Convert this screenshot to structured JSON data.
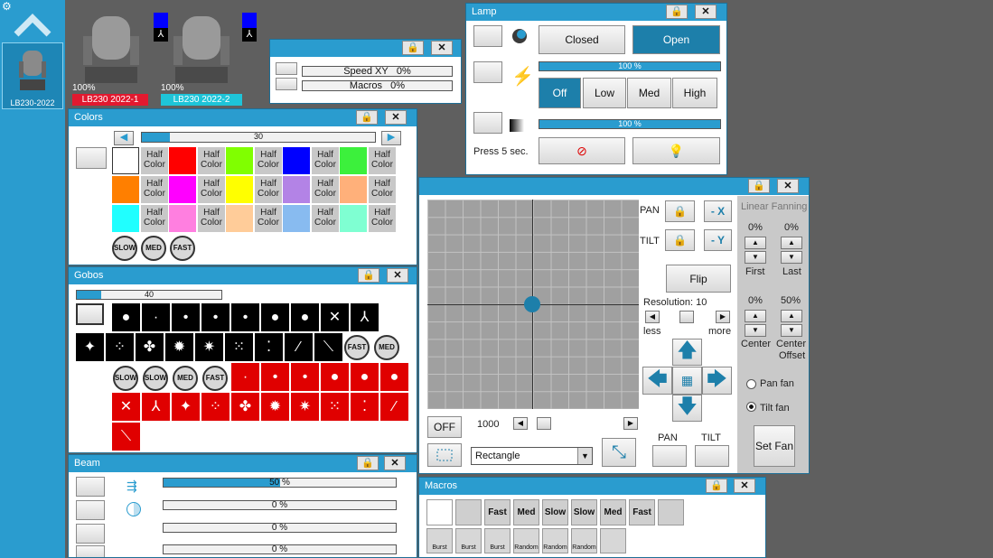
{
  "fixture_bar": {
    "selected_label": "LB230-2022",
    "fixtures": [
      {
        "percent": "100%",
        "label": "LB230 2022-1",
        "color": "#e2192f"
      },
      {
        "percent": "100%",
        "label": "LB230 2022-2",
        "color": "#1ec4d8"
      }
    ]
  },
  "speed_win": {
    "rows": [
      {
        "label": "Speed XY",
        "value": "0%"
      },
      {
        "label": "Macros",
        "value": "0%"
      }
    ]
  },
  "lamp": {
    "title": "Lamp",
    "closed": "Closed",
    "open": "Open",
    "dim_text": "100 %",
    "levels": [
      "Off",
      "Low",
      "Med",
      "High"
    ],
    "dim2_text": "100 %",
    "press": "Press 5 sec."
  },
  "colors": {
    "title": "Colors",
    "slider_value": "30",
    "half_line1": "Half",
    "half_line2": "Color",
    "swatches": [
      "#ffffff",
      "#ff0000",
      "#80ff00",
      "#0000ff",
      "#3cf03c",
      "#ff7f00",
      "#ff00ff",
      "#ffff00",
      "#b383e6",
      "#ffb07a",
      "#20ffff",
      "#ff7fe0",
      "#ffcc99",
      "#88bbf0",
      "#7fffd2"
    ],
    "speeds": [
      "SLOW",
      "MED",
      "FAST"
    ]
  },
  "gobos": {
    "title": "Gobos",
    "slider_value": "40",
    "speeds": [
      "SLOW",
      "SLOW",
      "MED",
      "FAST"
    ],
    "speeds2": [
      "FAST",
      "MED"
    ]
  },
  "beam": {
    "title": "Beam",
    "bars": [
      "50 %",
      "0 %",
      "0 %",
      "0 %"
    ],
    "values": [
      0.5,
      0,
      0,
      0
    ]
  },
  "macros": {
    "title": "Macros",
    "row1": [
      "",
      "",
      "Fast",
      "Med",
      "Slow",
      "Slow",
      "Med",
      "Fast",
      ""
    ],
    "row2": [
      "Burst",
      "Burst",
      "Burst",
      "Random",
      "Random",
      "Random",
      ""
    ]
  },
  "pantilt": {
    "pan": "PAN",
    "tilt": "TILT",
    "minus_x": "- X",
    "minus_y": "- Y",
    "flip": "Flip",
    "resolution": "Resolution: 10",
    "less": "less",
    "more": "more",
    "off": "OFF",
    "value": "1000",
    "shape": "Rectangle",
    "pan_btn": "PAN",
    "tilt_btn": "TILT",
    "fanning_title": "Linear Fanning",
    "first_pct": "0%",
    "last_pct": "0%",
    "first": "First",
    "last": "Last",
    "center_pct": "0%",
    "center_off_pct": "50%",
    "center": "Center",
    "center_offset_1": "Center",
    "center_offset_2": "Offset",
    "pan_fan": "Pan fan",
    "tilt_fan": "Tilt fan",
    "set_fan": "Set Fan"
  }
}
